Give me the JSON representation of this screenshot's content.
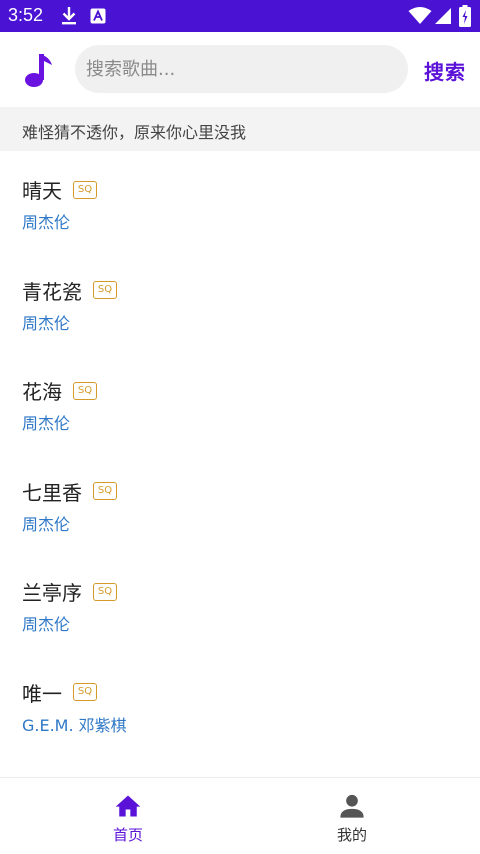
{
  "status_bar": {
    "time": "3:52",
    "icons": [
      "download-icon",
      "a-notification-icon",
      "wifi-icon",
      "signal-icon",
      "battery-icon"
    ],
    "color": "#4a12d3"
  },
  "header": {
    "logo_icon": "music-note-icon",
    "search_placeholder": "搜索歌曲...",
    "search_button": "搜索",
    "accent_color": "#5a12d8"
  },
  "banner": {
    "text": "难怪猜不透你，原来你心里没我"
  },
  "songs": [
    {
      "title": "晴天",
      "badge": "SQ",
      "artist": "周杰伦"
    },
    {
      "title": "青花瓷",
      "badge": "SQ",
      "artist": "周杰伦"
    },
    {
      "title": "花海",
      "badge": "SQ",
      "artist": "周杰伦"
    },
    {
      "title": "七里香",
      "badge": "SQ",
      "artist": "周杰伦"
    },
    {
      "title": "兰亭序",
      "badge": "SQ",
      "artist": "周杰伦"
    },
    {
      "title": "唯一",
      "badge": "SQ",
      "artist": "G.E.M. 邓紫棋"
    }
  ],
  "bottom_nav": [
    {
      "label": "首页",
      "icon": "home-icon",
      "active": true
    },
    {
      "label": "我的",
      "icon": "person-icon",
      "active": false
    }
  ]
}
